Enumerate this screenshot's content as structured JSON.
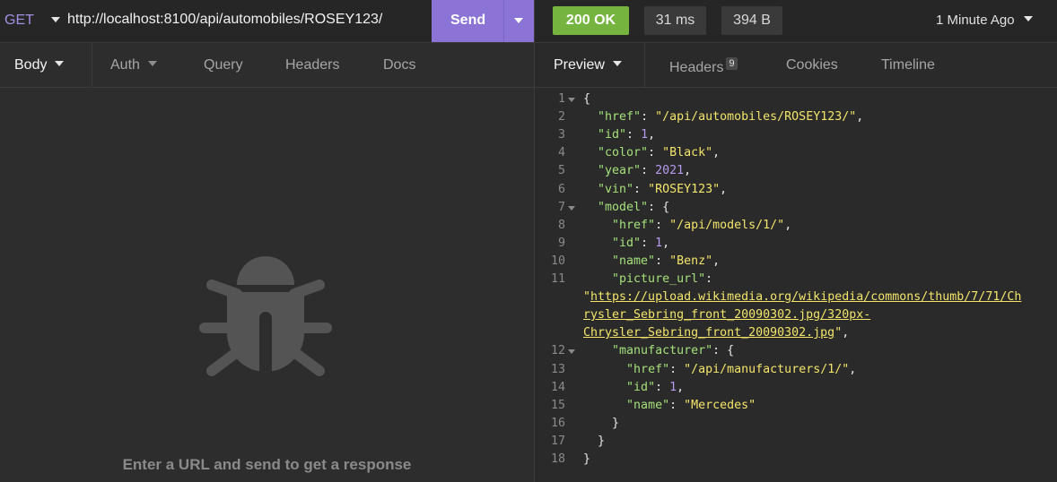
{
  "request": {
    "method": "GET",
    "url": "http://localhost:8100/api/automobiles/ROSEY123/",
    "send_label": "Send"
  },
  "request_tabs": [
    "Body",
    "Auth",
    "Query",
    "Headers",
    "Docs"
  ],
  "request_empty_message": "Enter a URL and send to get a response",
  "response": {
    "status": "200 OK",
    "time": "31 ms",
    "size": "394 B",
    "ago": "1 Minute Ago",
    "tabs": [
      "Preview",
      "Headers",
      "Cookies",
      "Timeline"
    ],
    "headers_count": "9"
  },
  "colors": {
    "accent": "#8b74d6",
    "status_ok": "#75b53f",
    "json_key": "#a5e07a",
    "json_string": "#f3e56b",
    "json_number": "#b59cf0"
  },
  "code_lines": [
    {
      "n": "1",
      "fold": true,
      "text": "{"
    },
    {
      "n": "2",
      "text": "  \"href\": \"/api/automobiles/ROSEY123/\","
    },
    {
      "n": "3",
      "text": "  \"id\": 1,"
    },
    {
      "n": "4",
      "text": "  \"color\": \"Black\","
    },
    {
      "n": "5",
      "text": "  \"year\": 2021,"
    },
    {
      "n": "6",
      "text": "  \"vin\": \"ROSEY123\","
    },
    {
      "n": "7",
      "fold": true,
      "text": "  \"model\": {"
    },
    {
      "n": "8",
      "text": "    \"href\": \"/api/models/1/\","
    },
    {
      "n": "9",
      "text": "    \"id\": 1,"
    },
    {
      "n": "10",
      "text": "    \"name\": \"Benz\","
    },
    {
      "n": "11",
      "text": "    \"picture_url\":"
    },
    {
      "n": "",
      "text": "\"https://upload.wikimedia.org/wikipedia/commons/thumb/7/71/Ch"
    },
    {
      "n": "",
      "text": "rysler_Sebring_front_20090302.jpg/320px-"
    },
    {
      "n": "",
      "text": "Chrysler_Sebring_front_20090302.jpg\","
    },
    {
      "n": "12",
      "fold": true,
      "text": "    \"manufacturer\": {"
    },
    {
      "n": "13",
      "text": "      \"href\": \"/api/manufacturers/1/\","
    },
    {
      "n": "14",
      "text": "      \"id\": 1,"
    },
    {
      "n": "15",
      "text": "      \"name\": \"Mercedes\""
    },
    {
      "n": "16",
      "text": "    }"
    },
    {
      "n": "17",
      "text": "  }"
    },
    {
      "n": "18",
      "text": "}"
    }
  ]
}
